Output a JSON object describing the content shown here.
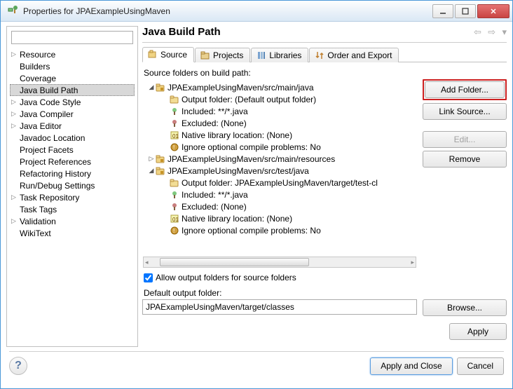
{
  "titlebar": {
    "title": "Properties for JPAExampleUsingMaven"
  },
  "sidebar": {
    "filter_placeholder": "",
    "items": [
      {
        "label": "Resource",
        "hasChildren": true,
        "selected": false
      },
      {
        "label": "Builders",
        "hasChildren": false,
        "selected": false
      },
      {
        "label": "Coverage",
        "hasChildren": false,
        "selected": false
      },
      {
        "label": "Java Build Path",
        "hasChildren": false,
        "selected": true
      },
      {
        "label": "Java Code Style",
        "hasChildren": true,
        "selected": false
      },
      {
        "label": "Java Compiler",
        "hasChildren": true,
        "selected": false
      },
      {
        "label": "Java Editor",
        "hasChildren": true,
        "selected": false
      },
      {
        "label": "Javadoc Location",
        "hasChildren": false,
        "selected": false
      },
      {
        "label": "Project Facets",
        "hasChildren": false,
        "selected": false
      },
      {
        "label": "Project References",
        "hasChildren": false,
        "selected": false
      },
      {
        "label": "Refactoring History",
        "hasChildren": false,
        "selected": false
      },
      {
        "label": "Run/Debug Settings",
        "hasChildren": false,
        "selected": false
      },
      {
        "label": "Task Repository",
        "hasChildren": true,
        "selected": false
      },
      {
        "label": "Task Tags",
        "hasChildren": false,
        "selected": false
      },
      {
        "label": "Validation",
        "hasChildren": true,
        "selected": false
      },
      {
        "label": "WikiText",
        "hasChildren": false,
        "selected": false
      }
    ]
  },
  "main": {
    "title": "Java Build Path",
    "tabs": [
      {
        "label": "Source",
        "selected": true
      },
      {
        "label": "Projects",
        "selected": false
      },
      {
        "label": "Libraries",
        "selected": false
      },
      {
        "label": "Order and Export",
        "selected": false
      }
    ],
    "section_label": "Source folders on build path:",
    "source_tree": [
      {
        "type": "folder",
        "label": "JPAExampleUsingMaven/src/main/java",
        "expanded": true
      },
      {
        "type": "detail",
        "icon": "output",
        "label": "Output folder: (Default output folder)"
      },
      {
        "type": "detail",
        "icon": "included",
        "label": "Included: **/*.java"
      },
      {
        "type": "detail",
        "icon": "excluded",
        "label": "Excluded: (None)"
      },
      {
        "type": "detail",
        "icon": "native",
        "label": "Native library location: (None)"
      },
      {
        "type": "detail",
        "icon": "ignore",
        "label": "Ignore optional compile problems: No"
      },
      {
        "type": "folder",
        "label": "JPAExampleUsingMaven/src/main/resources",
        "expanded": false
      },
      {
        "type": "folder",
        "label": "JPAExampleUsingMaven/src/test/java",
        "expanded": true
      },
      {
        "type": "detail",
        "icon": "output",
        "label": "Output folder: JPAExampleUsingMaven/target/test-cl"
      },
      {
        "type": "detail",
        "icon": "included",
        "label": "Included: **/*.java"
      },
      {
        "type": "detail",
        "icon": "excluded",
        "label": "Excluded: (None)"
      },
      {
        "type": "detail",
        "icon": "native",
        "label": "Native library location: (None)"
      },
      {
        "type": "detail",
        "icon": "ignore",
        "label": "Ignore optional compile problems: No"
      }
    ],
    "buttons": {
      "add_folder": "Add Folder...",
      "link_source": "Link Source...",
      "edit": "Edit...",
      "remove": "Remove"
    },
    "allow_output_check": {
      "checked": true,
      "label": "Allow output folders for source folders"
    },
    "default_output_label": "Default output folder:",
    "default_output_value": "JPAExampleUsingMaven/target/classes",
    "browse_button": "Browse...",
    "apply_button": "Apply"
  },
  "bottom": {
    "apply_close": "Apply and Close",
    "cancel": "Cancel"
  }
}
